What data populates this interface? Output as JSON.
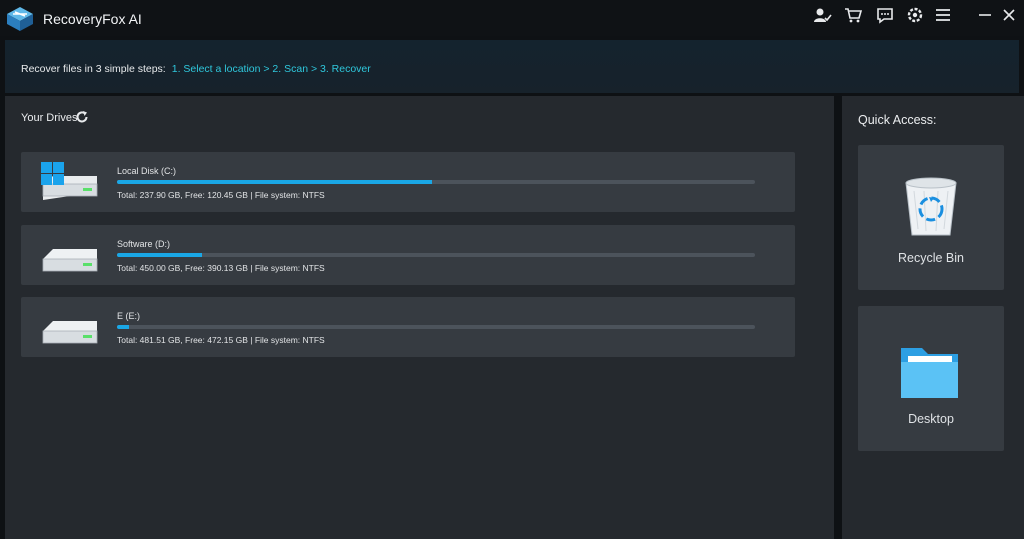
{
  "app": {
    "title": "RecoveryFox AI"
  },
  "toolbar": {
    "icons": [
      "account-icon",
      "cart-icon",
      "feedback-icon",
      "settings-icon",
      "menu-icon",
      "minimize-icon",
      "close-icon"
    ]
  },
  "steps": {
    "prefix": "Recover files in 3 simple steps:",
    "path": "1. Select a location > 2. Scan > 3. Recover"
  },
  "drives": {
    "heading": "Your Drives",
    "items": [
      {
        "name": "Local Disk (C:)",
        "info": "Total: 237.90 GB, Free: 120.45 GB | File system: NTFS",
        "used_fraction": 0.494,
        "icon": "windows-drive-icon"
      },
      {
        "name": "Software (D:)",
        "info": "Total: 450.00 GB, Free: 390.13 GB | File system: NTFS",
        "used_fraction": 0.133,
        "icon": "hard-drive-icon"
      },
      {
        "name": "E (E:)",
        "info": "Total: 481.51 GB, Free: 472.15 GB | File system: NTFS",
        "used_fraction": 0.019,
        "icon": "hard-drive-icon"
      }
    ]
  },
  "quick_access": {
    "heading": "Quick Access:",
    "items": [
      {
        "label": "Recycle Bin",
        "icon": "recycle-bin-icon"
      },
      {
        "label": "Desktop",
        "icon": "folder-icon"
      }
    ]
  },
  "colors": {
    "accent": "#1aa7e6",
    "link": "#2fc7dc",
    "panel": "#25292e",
    "card": "#363b41"
  }
}
